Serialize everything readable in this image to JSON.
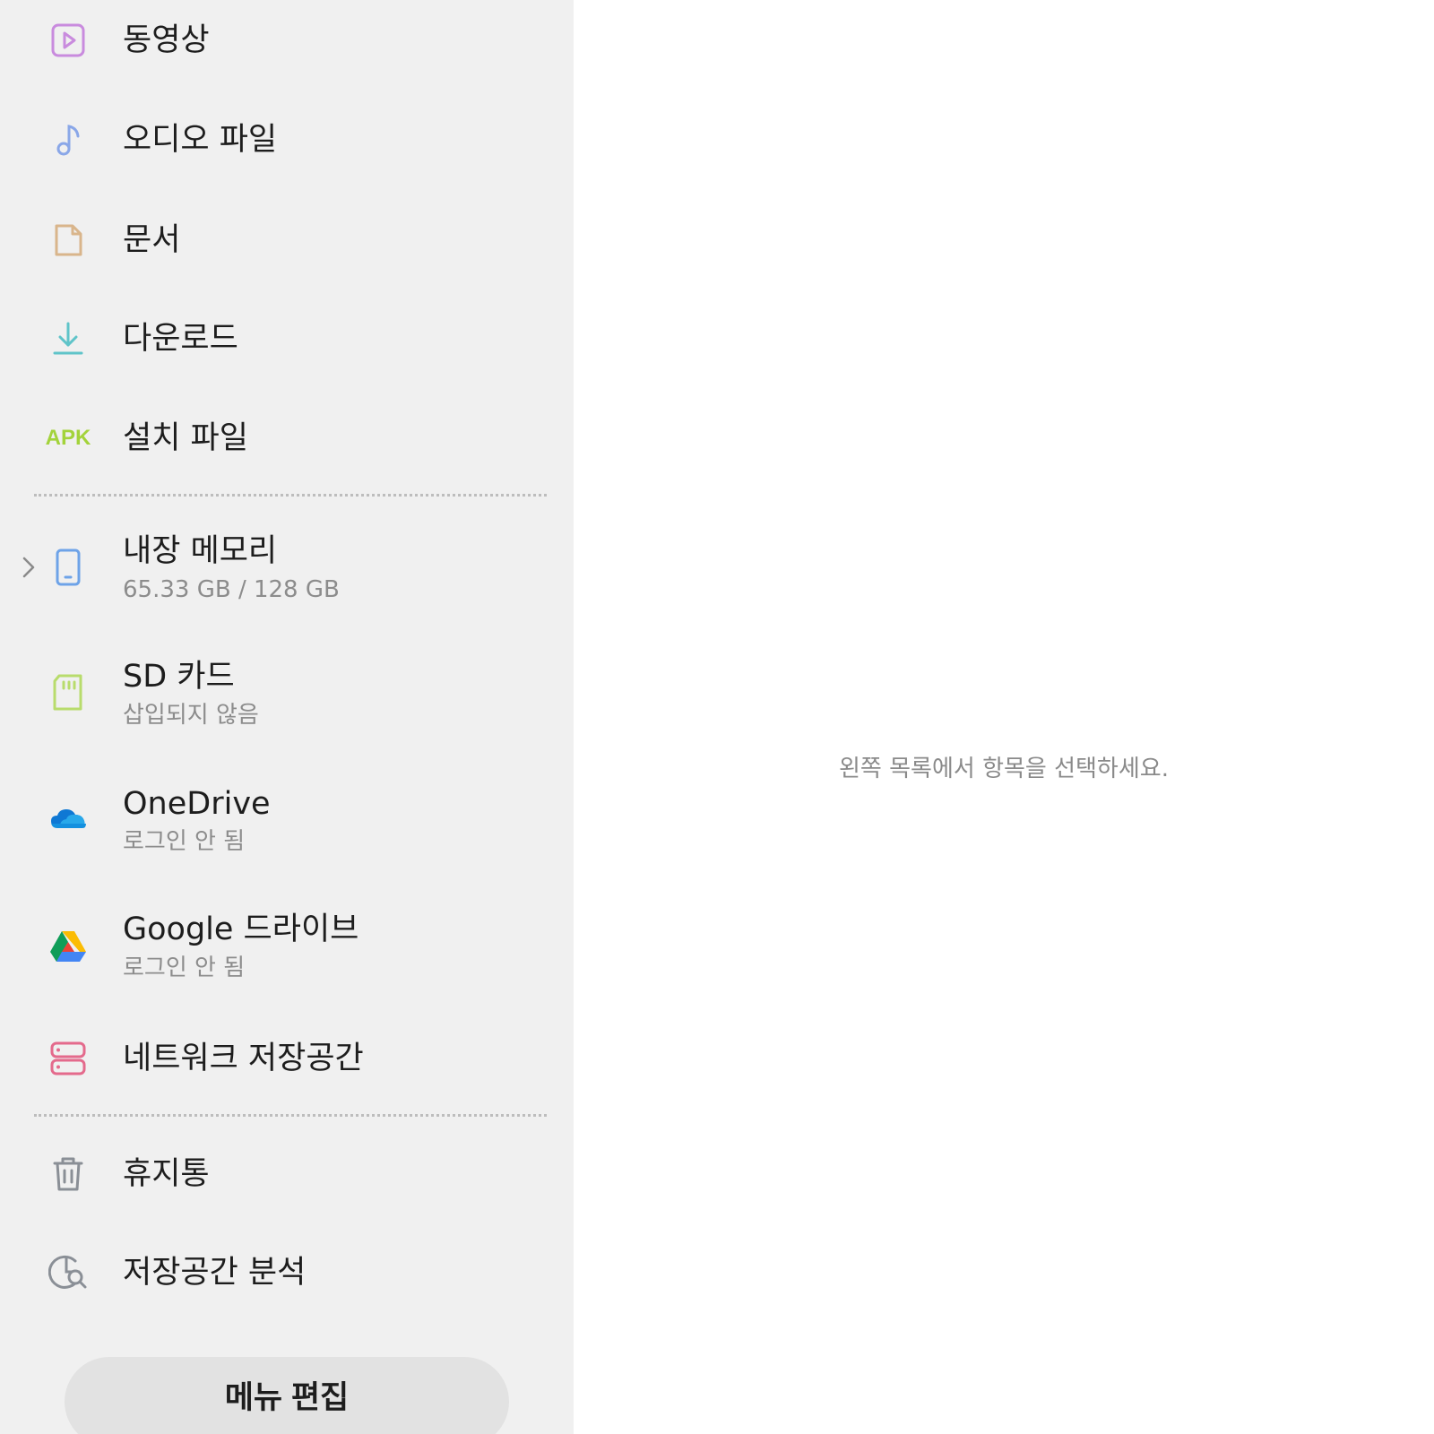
{
  "sidebar": {
    "media_items": [
      {
        "label": "동영상",
        "icon": "video-icon",
        "color": "#c98bde"
      },
      {
        "label": "오디오 파일",
        "icon": "music-note-icon",
        "color": "#8aa7e8"
      },
      {
        "label": "문서",
        "icon": "document-icon",
        "color": "#d9b58b"
      },
      {
        "label": "다운로드",
        "icon": "download-icon",
        "color": "#5fc4c9"
      },
      {
        "label": "설치 파일",
        "icon": "apk-icon",
        "icon_text": "APK",
        "color": "#a3d33b"
      }
    ],
    "storage_items": [
      {
        "label": "내장 메모리",
        "sub": "65.33 GB / 128 GB",
        "icon": "phone-icon",
        "color": "#6ea3e8"
      },
      {
        "label": "SD 카드",
        "sub": "삽입되지 않음",
        "icon": "sd-card-icon",
        "color": "#b8dc6c"
      },
      {
        "label": "OneDrive",
        "sub": "로그인 안 됨",
        "icon": "onedrive-icon",
        "color": "#1a7ad4"
      },
      {
        "label": "Google 드라이브",
        "sub": "로그인 안 됨",
        "icon": "google-drive-icon",
        "color": "#34a853"
      },
      {
        "label": "네트워크 저장공간",
        "icon": "network-storage-icon",
        "color": "#e46a8c"
      }
    ],
    "tool_items": [
      {
        "label": "휴지통",
        "icon": "trash-icon",
        "color": "#8a8f96"
      },
      {
        "label": "저장공간 분석",
        "icon": "storage-analysis-icon",
        "color": "#8a8f96"
      }
    ],
    "edit_button": "메뉴 편집"
  },
  "content": {
    "empty_message": "왼쪽 목록에서 항목을 선택하세요."
  }
}
